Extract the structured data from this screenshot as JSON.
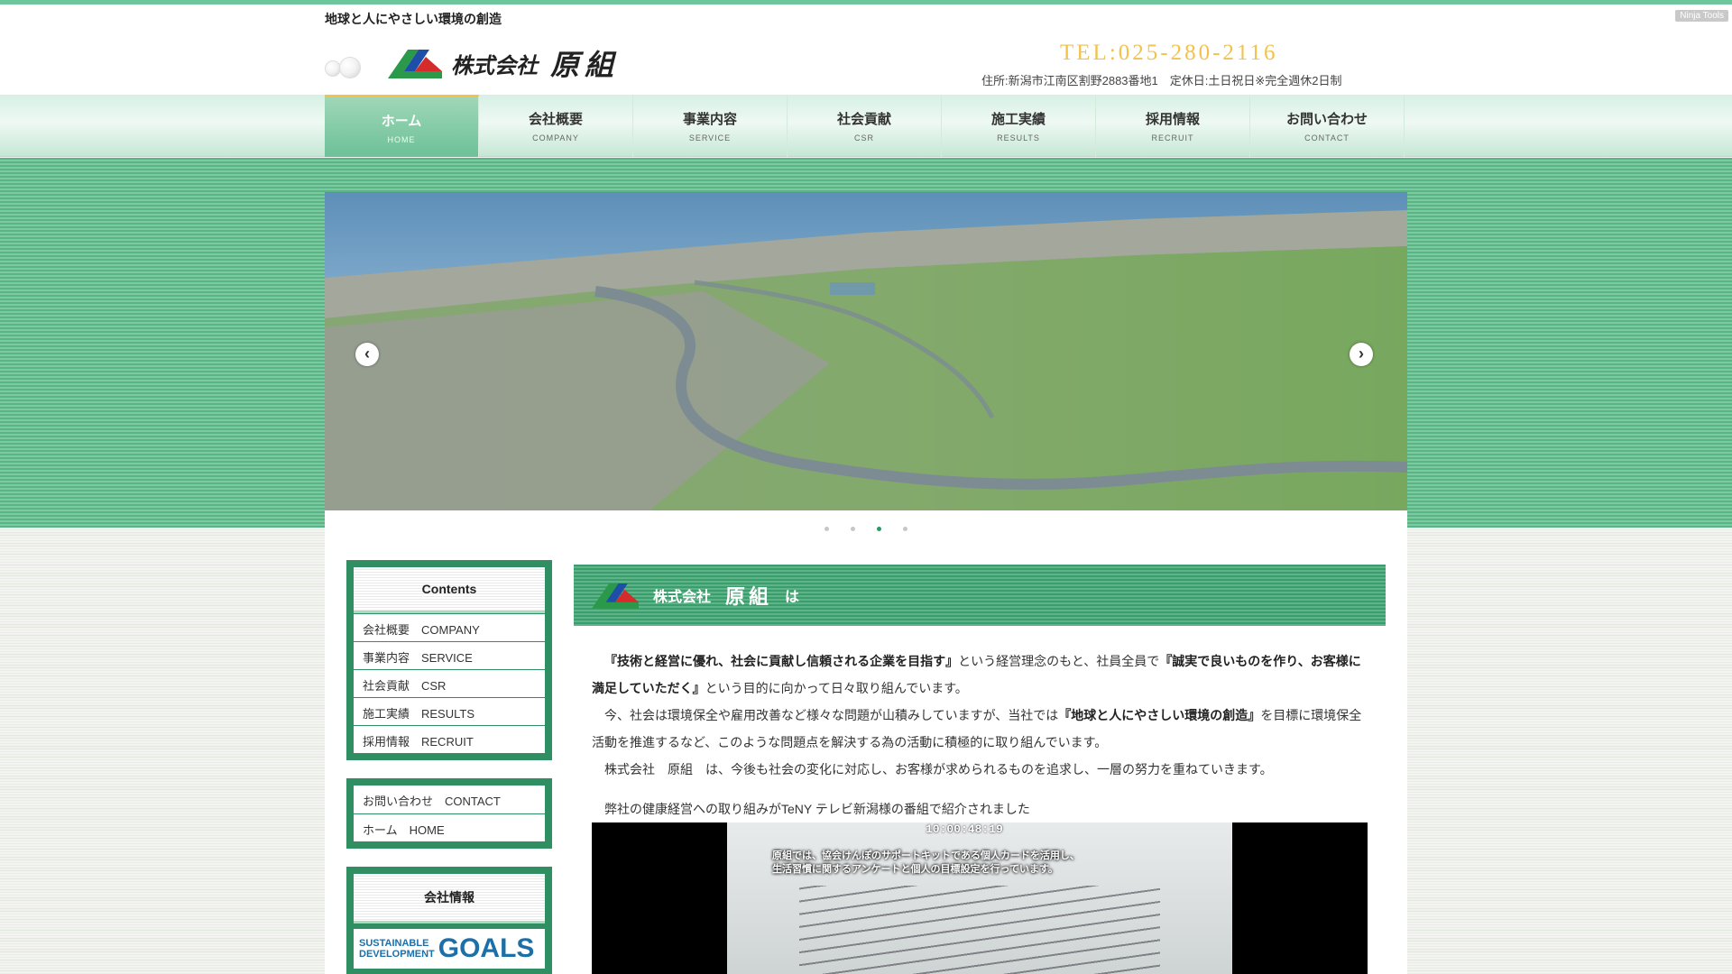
{
  "header": {
    "tagline": "地球と人にやさしい環境の創造",
    "ninja_tools": "Ninja Tools",
    "company_prefix": "株式会社",
    "company_name": "原組",
    "tel": "TEL:025-280-2116",
    "address": "住所:新潟市江南区割野2883番地1　定休日:土日祝日※完全週休2日制"
  },
  "nav": [
    {
      "jp": "ホーム",
      "en": "HOME",
      "active": true
    },
    {
      "jp": "会社概要",
      "en": "COMPANY"
    },
    {
      "jp": "事業内容",
      "en": "SERVICE"
    },
    {
      "jp": "社会貢献",
      "en": "CSR"
    },
    {
      "jp": "施工実績",
      "en": "RESULTS"
    },
    {
      "jp": "採用情報",
      "en": "RECRUIT"
    },
    {
      "jp": "お問い合わせ",
      "en": "CONTACT"
    }
  ],
  "slider": {
    "prev_glyph": "‹",
    "next_glyph": "›",
    "dot_count": 4,
    "active_dot": 3
  },
  "sidebar": {
    "contents_title": "Contents",
    "contents_items": [
      "会社概要　COMPANY",
      "事業内容　SERVICE",
      "社会貢献　CSR",
      "施工実績　RESULTS",
      "採用情報　RECRUIT"
    ],
    "links": [
      "お問い合わせ　CONTACT",
      "ホーム　HOME"
    ],
    "company_info_title": "会社情報",
    "sdgs_line1": "SUSTAINABLE",
    "sdgs_line2": "DEVELOPMENT",
    "sdgs_goals": "GOALS"
  },
  "main": {
    "heading_prefix": "株式会社",
    "heading_name": "原組",
    "heading_suffix": "は",
    "p1_b1": "『技術と経営に優れ、社会に貢献し信頼される企業を目指す』",
    "p1_t1": "という経営理念のもと、社員全員で",
    "p1_b2": "『誠実で良いものを作り、お客様に満足していただく』",
    "p1_t2": "という目的に向かって日々取り組んでいます。",
    "p2_t1": "今、社会は環境保全や雇用改善など様々な問題が山積みしていますが、当社では",
    "p2_b1": "『地球と人にやさしい環境の創造』",
    "p2_t2": "を目標に環境保全活動を推進するなど、このような問題点を解決する為の活動に積極的に取り組んでいます。",
    "p3": "株式会社　原組　は、今後も社会の変化に対応し、お客様が求められるものを追求し、一層の努力を重ねていきます。",
    "video_caption": "弊社の健康経営への取り組みがTeNY テレビ新潟様の番組で紹介されました",
    "video_timecode": "10:00:48:19",
    "video_subtitle": "原組では、協会けんぽのサポートキットである個人カードを活用し、\n生活習慣に関するアンケートと個人の目標設定を行っています。"
  },
  "colors": {
    "accent_green": "#2f8f62",
    "tel_gold": "#f2c24a",
    "nav_active": "#6cc197"
  }
}
